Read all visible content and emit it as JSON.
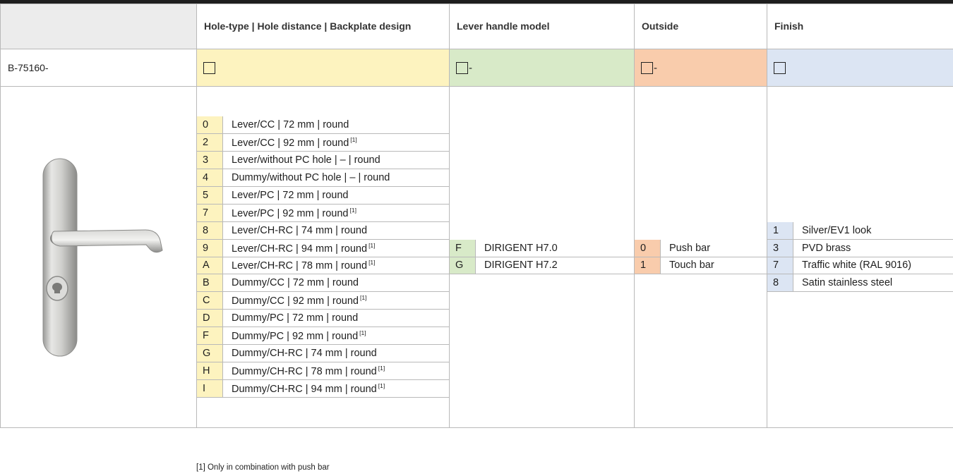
{
  "header": {
    "hole_type_label": "Hole-type | Hole distance | Backplate design",
    "lever_label": "Lever handle model",
    "outside_label": "Outside",
    "finish_label": "Finish"
  },
  "product_code": "B-75160-",
  "code_row": {
    "dash": "-"
  },
  "hole_types": [
    {
      "code": "0",
      "desc": "Lever/CC | 72 mm | round",
      "ref": ""
    },
    {
      "code": "2",
      "desc": "Lever/CC | 92 mm | round",
      "ref": "[1]"
    },
    {
      "code": "3",
      "desc": "Lever/without PC hole | – | round",
      "ref": ""
    },
    {
      "code": "4",
      "desc": "Dummy/without PC hole | – | round",
      "ref": ""
    },
    {
      "code": "5",
      "desc": "Lever/PC | 72 mm | round",
      "ref": ""
    },
    {
      "code": "7",
      "desc": "Lever/PC | 92 mm | round",
      "ref": "[1]"
    },
    {
      "code": "8",
      "desc": "Lever/CH-RC | 74 mm | round",
      "ref": ""
    },
    {
      "code": "9",
      "desc": "Lever/CH-RC | 94 mm | round",
      "ref": "[1]"
    },
    {
      "code": "A",
      "desc": "Lever/CH-RC | 78 mm | round",
      "ref": "[1]"
    },
    {
      "code": "B",
      "desc": "Dummy/CC | 72 mm | round",
      "ref": ""
    },
    {
      "code": "C",
      "desc": "Dummy/CC | 92 mm | round",
      "ref": "[1]"
    },
    {
      "code": "D",
      "desc": "Dummy/PC | 72 mm | round",
      "ref": ""
    },
    {
      "code": "F",
      "desc": "Dummy/PC | 92 mm | round",
      "ref": "[1]"
    },
    {
      "code": "G",
      "desc": "Dummy/CH-RC | 74 mm | round",
      "ref": ""
    },
    {
      "code": "H",
      "desc": "Dummy/CH-RC | 78 mm | round",
      "ref": "[1]"
    },
    {
      "code": "I",
      "desc": "Dummy/CH-RC | 94 mm | round",
      "ref": "[1]"
    }
  ],
  "lever_models": [
    {
      "code": "F",
      "desc": "DIRIGENT H7.0"
    },
    {
      "code": "G",
      "desc": "DIRIGENT H7.2"
    }
  ],
  "outside_options": [
    {
      "code": "0",
      "desc": "Push bar"
    },
    {
      "code": "1",
      "desc": "Touch bar"
    }
  ],
  "finish_options": [
    {
      "code": "1",
      "desc": "Silver/EV1 look"
    },
    {
      "code": "3",
      "desc": "PVD brass"
    },
    {
      "code": "7",
      "desc": "Traffic white (RAL 9016)"
    },
    {
      "code": "8",
      "desc": "Satin stainless steel"
    }
  ],
  "footnote": "[1] Only in combination with push bar",
  "colors": {
    "hole_type": "#fdf3bf",
    "lever": "#d8eac8",
    "outside": "#f9ccac",
    "finish": "#dce5f3"
  },
  "image": {
    "icon": "lever-handle-product-photo"
  }
}
